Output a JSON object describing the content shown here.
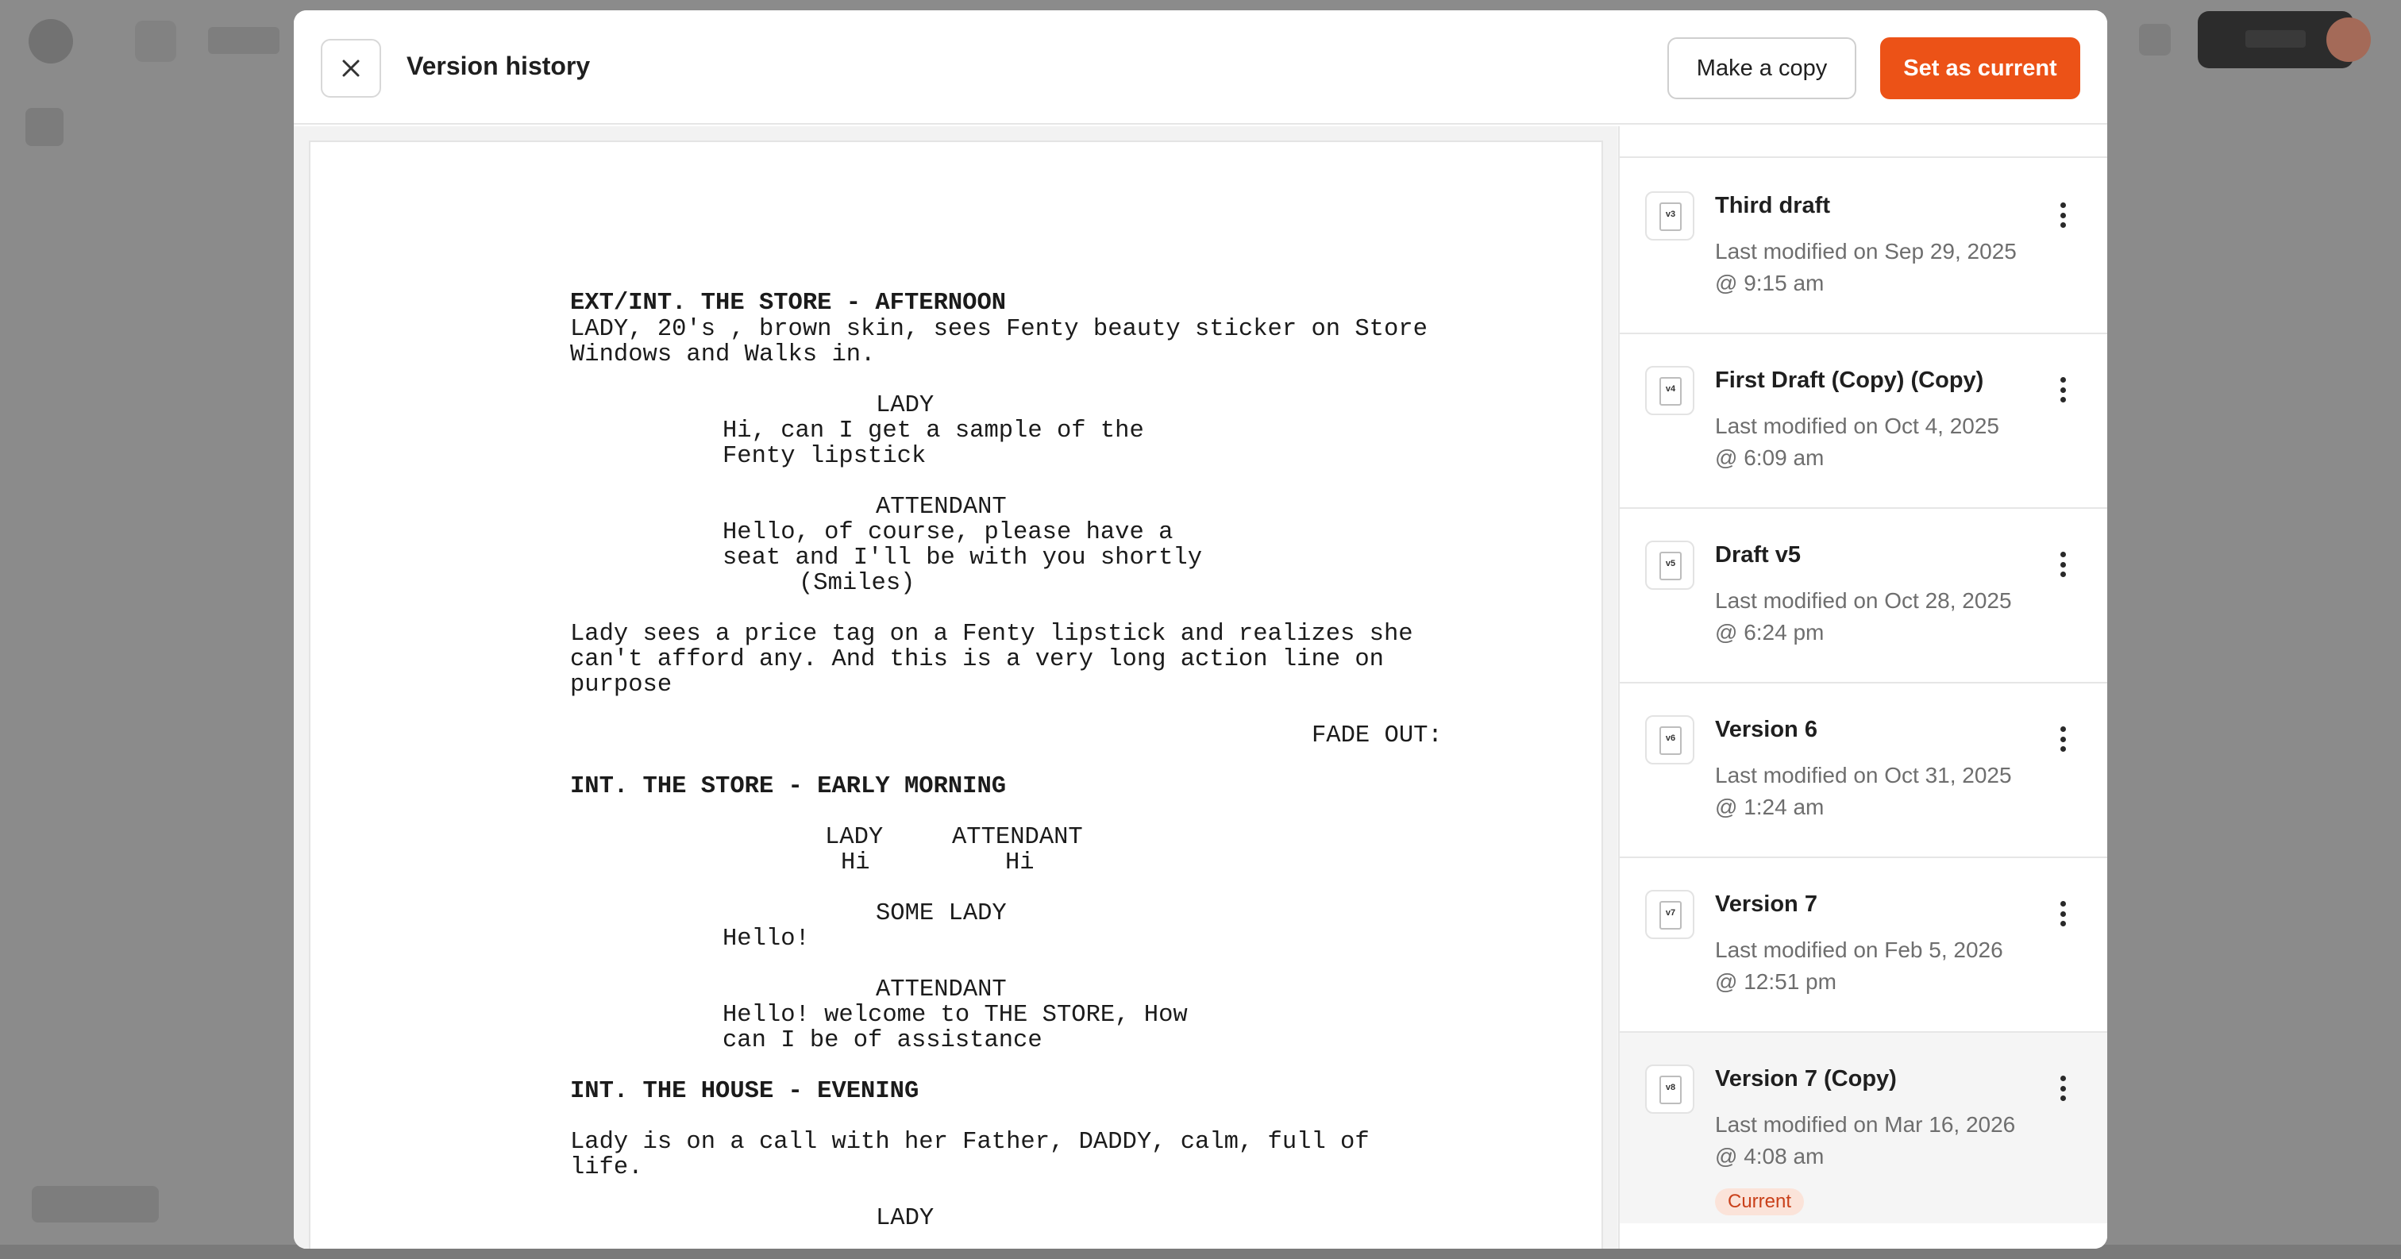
{
  "modal": {
    "title": "Version history",
    "make_copy_label": "Make a copy",
    "set_current_label": "Set as current"
  },
  "colors": {
    "accent": "#ec5217",
    "badge_bg": "#fbe3d9",
    "badge_text": "#c9401a"
  },
  "screenplay": {
    "lines": [
      "EXT/INT. THE STORE - AFTERNOON",
      "LADY, 20's , brown skin, sees Fenty beauty sticker on Store",
      "Windows and Walks in.",
      "LADY",
      "Hi, can I get a sample of the",
      "Fenty lipstick",
      "ATTENDANT",
      "Hello, of course, please have a",
      "seat and I'll be with you shortly",
      "(Smiles)",
      "Lady sees a price tag on a Fenty lipstick and realizes she",
      "can't afford any. And this is a very long action line on",
      "purpose",
      "FADE OUT:",
      "INT. THE STORE - EARLY MORNING",
      "LADY",
      "ATTENDANT",
      "Hi",
      "Hi",
      "SOME LADY",
      "Hello!",
      "ATTENDANT",
      "Hello! welcome to THE STORE, How",
      "can I be of assistance",
      "INT. THE HOUSE - EVENING",
      "Lady is on a call with her Father, DADDY, calm, full of",
      "life.",
      "LADY"
    ]
  },
  "versions": [
    {
      "tag": "v3",
      "name": "Third draft",
      "date": "Last modified on Sep 29, 2025 @ 9:15 am"
    },
    {
      "tag": "v4",
      "name": "First Draft (Copy) (Copy)",
      "date": "Last modified on Oct 4, 2025 @ 6:09 am"
    },
    {
      "tag": "v5",
      "name": "Draft v5",
      "date": "Last modified on Oct 28, 2025 @ 6:24 pm"
    },
    {
      "tag": "v6",
      "name": "Version 6",
      "date": "Last modified on Oct 31, 2025 @ 1:24 am"
    },
    {
      "tag": "v7",
      "name": "Version 7",
      "date": "Last modified on Feb 5, 2026 @ 12:51 pm"
    },
    {
      "tag": "v8",
      "name": "Version 7 (Copy)",
      "date": "Last modified on Mar 16, 2026 @ 4:08 am",
      "badge": "Current"
    }
  ]
}
